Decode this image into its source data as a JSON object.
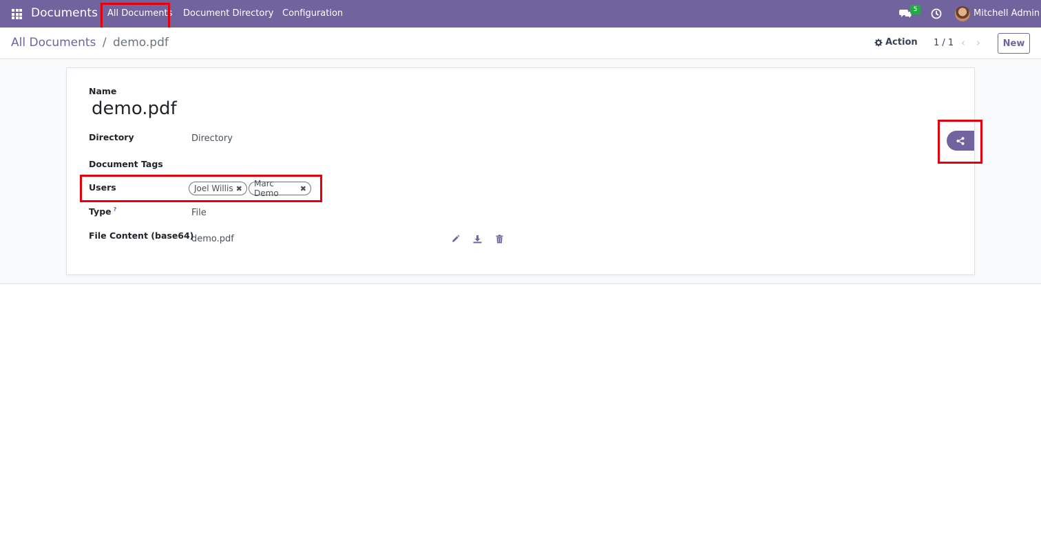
{
  "navbar": {
    "app_name": "Documents",
    "menu": [
      "All Documents",
      "Document Directory",
      "Configuration"
    ],
    "chat_count": "5",
    "user_name": "Mitchell Admin"
  },
  "control_panel": {
    "breadcrumb": {
      "parent": "All Documents",
      "separator": "/",
      "current": "demo.pdf"
    },
    "action_label": "Action",
    "pager": "1 / 1",
    "new_label": "New"
  },
  "form": {
    "name_label": "Name",
    "name_value": "demo.pdf",
    "directory_label": "Directory",
    "directory_value": "Directory",
    "tags_label": "Document Tags",
    "users_label": "Users",
    "users": [
      "Joel Willis",
      "Marc Demo"
    ],
    "type_label": "Type",
    "type_help": "?",
    "type_value": "File",
    "content_label": "File Content (base64)",
    "content_value": "demo.pdf"
  },
  "colors": {
    "brand": "#71639e",
    "highlight": "#e5000b",
    "badge": "#28a745"
  },
  "icons": [
    "apps-icon",
    "chat-icon",
    "clock-icon",
    "gear-icon",
    "chevron-left-icon",
    "chevron-right-icon",
    "edit-icon",
    "download-icon",
    "trash-icon",
    "share-icon"
  ]
}
